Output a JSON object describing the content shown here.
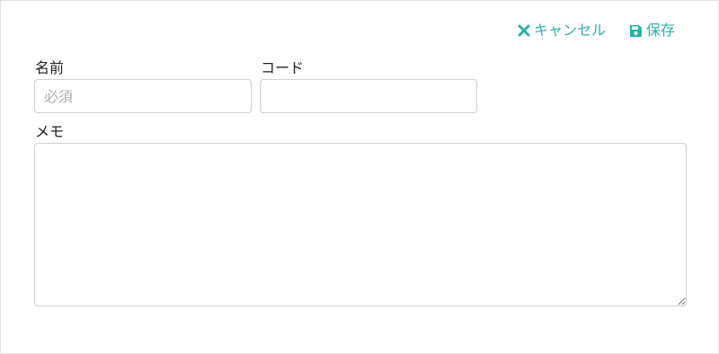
{
  "toolbar": {
    "cancel_label": "キャンセル",
    "save_label": "保存",
    "accent_color": "#2bb3a8",
    "cancel_icon": "close-icon",
    "save_icon": "floppy-disk-icon"
  },
  "form": {
    "name": {
      "label": "名前",
      "value": "",
      "placeholder": "必須"
    },
    "code": {
      "label": "コード",
      "value": "",
      "placeholder": ""
    },
    "memo": {
      "label": "メモ",
      "value": "",
      "placeholder": ""
    }
  }
}
